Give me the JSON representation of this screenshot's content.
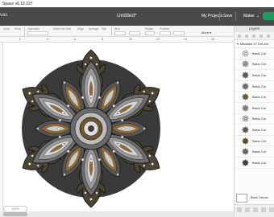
{
  "window": {
    "title": "Space v6.12.227"
  },
  "appbar": {
    "left_label": "vas",
    "project_title": "Untitled*",
    "my_projects": "My Projects",
    "save": "Save",
    "machine": "Maker",
    "machine_caret": "⌄",
    "brand_color": "#1c9d5b"
  },
  "toolbar": {
    "tools": [
      "Undo",
      "Redo",
      "Operation",
      "Select All",
      "Edit",
      "Align",
      "Arrange",
      "Flip",
      "Size",
      "Rotate",
      "Position"
    ],
    "more": "More ▾"
  },
  "ruler": {
    "ticks": [
      "2",
      "4",
      "6",
      "8",
      "10",
      "12",
      "14",
      "16"
    ]
  },
  "canvas": {
    "zoom": "100%"
  },
  "layers": {
    "header": "Layers",
    "group_name": "Mandala 07 Det Aln",
    "items": [
      {
        "label": "Basic Cut",
        "color": "#ffffff"
      },
      {
        "label": "Basic Cut",
        "color": "#bdbdbd"
      },
      {
        "label": "Basic Cut",
        "color": "#6e6e6e"
      },
      {
        "label": "Basic Cut",
        "color": "#888888"
      },
      {
        "label": "Basic Cut",
        "color": "#8a6a3c"
      },
      {
        "label": "Basic Cut",
        "color": "#a3a3a3"
      },
      {
        "label": "Basic Cut",
        "color": "#e0e0e0"
      },
      {
        "label": "Basic Cut",
        "color": "#6a6a6a"
      },
      {
        "label": "Basic Cut",
        "color": "#6b5630"
      },
      {
        "label": "Basic Cut",
        "color": "#7a7a7a"
      },
      {
        "label": "Basic Cut",
        "color": "#3f3f3f"
      }
    ],
    "blank_canvas": "Blank Canvas"
  }
}
